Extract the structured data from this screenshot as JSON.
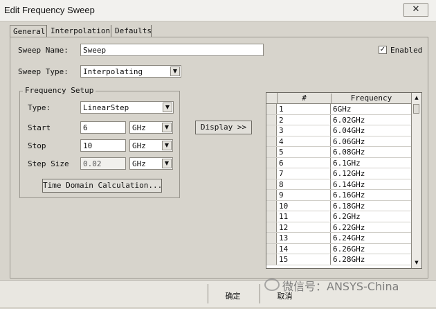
{
  "window": {
    "title": "Edit Frequency Sweep",
    "close_glyph": "✕"
  },
  "tabs": [
    {
      "label": "General"
    },
    {
      "label": "Interpolation"
    },
    {
      "label": "Defaults"
    }
  ],
  "general": {
    "sweep_name_label": "Sweep Name:",
    "sweep_name_value": "Sweep",
    "enabled_label": "Enabled",
    "enabled_checked": true,
    "check_glyph": "✓",
    "sweep_type_label": "Sweep Type:",
    "sweep_type_value": "Interpolating"
  },
  "frequency_setup": {
    "title": "Frequency Setup",
    "type_label": "Type:",
    "type_value": "LinearStep",
    "start_label": "Start",
    "start_value": "6",
    "start_unit": "GHz",
    "stop_label": "Stop",
    "stop_value": "10",
    "stop_unit": "GHz",
    "step_label": "Step Size",
    "step_value": "0.02",
    "step_unit": "GHz",
    "time_domain_button": "Time Domain Calculation..."
  },
  "display_button": "Display >>",
  "table": {
    "headers": {
      "num": "#",
      "freq": "Frequency"
    },
    "rows": [
      {
        "num": "1",
        "freq": "6GHz"
      },
      {
        "num": "2",
        "freq": "6.02GHz"
      },
      {
        "num": "3",
        "freq": "6.04GHz"
      },
      {
        "num": "4",
        "freq": "6.06GHz"
      },
      {
        "num": "5",
        "freq": "6.08GHz"
      },
      {
        "num": "6",
        "freq": "6.1GHz"
      },
      {
        "num": "7",
        "freq": "6.12GHz"
      },
      {
        "num": "8",
        "freq": "6.14GHz"
      },
      {
        "num": "9",
        "freq": "6.16GHz"
      },
      {
        "num": "10",
        "freq": "6.18GHz"
      },
      {
        "num": "11",
        "freq": "6.2GHz"
      },
      {
        "num": "12",
        "freq": "6.22GHz"
      },
      {
        "num": "13",
        "freq": "6.24GHz"
      },
      {
        "num": "14",
        "freq": "6.26GHz"
      },
      {
        "num": "15",
        "freq": "6.28GHz"
      }
    ],
    "scroll_up_glyph": "▲",
    "scroll_down_glyph": "▼"
  },
  "select_arrow_glyph": "▼",
  "footer": {
    "ok_label": "确定",
    "cancel_label": "取消"
  },
  "watermark": "微信号：ANSYS-China"
}
